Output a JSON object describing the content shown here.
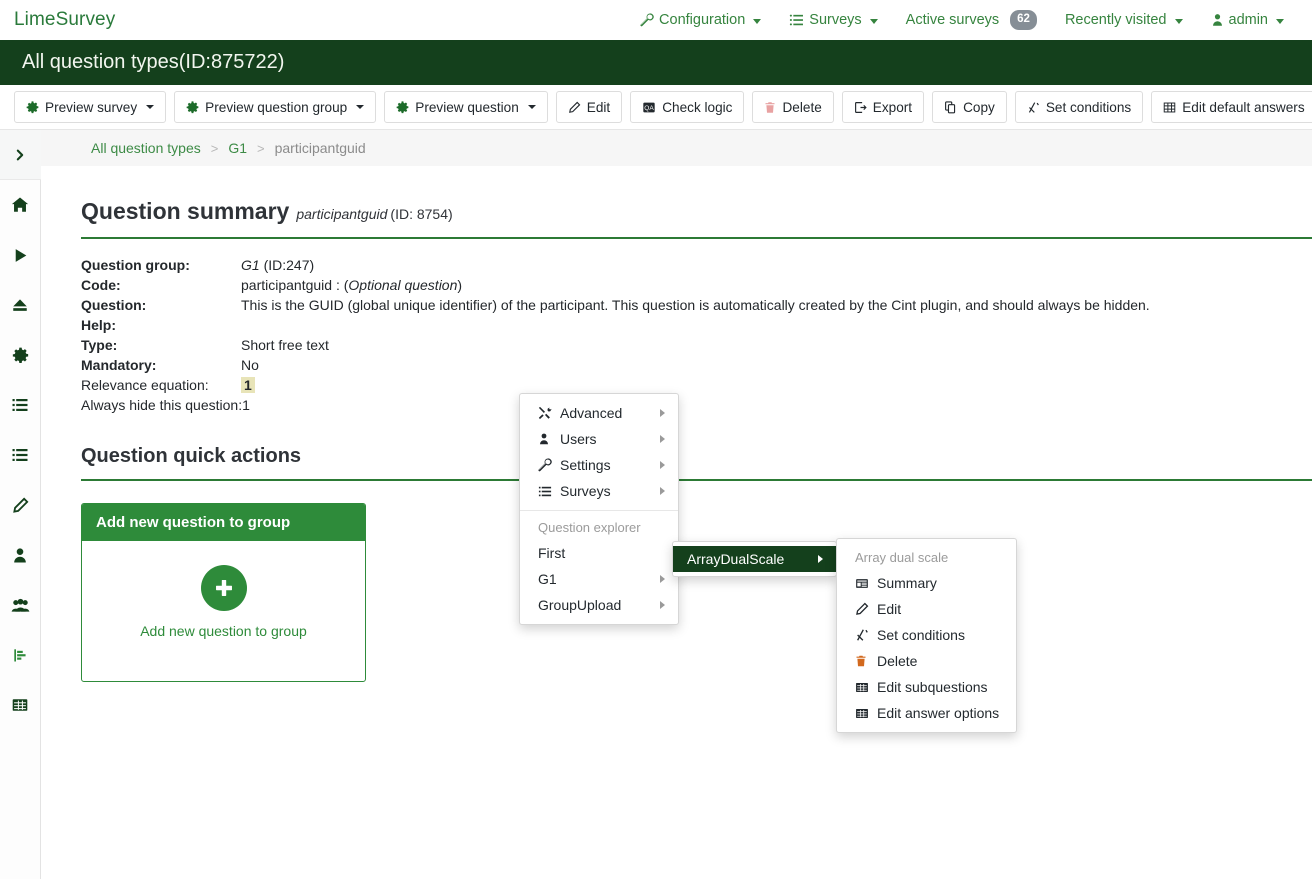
{
  "topnav": {
    "brand": "LimeSurvey",
    "items": [
      {
        "label": "Configuration",
        "icon": "wrench-icon",
        "caret": true
      },
      {
        "label": "Surveys",
        "icon": "list-icon",
        "caret": true
      },
      {
        "label": "Active surveys",
        "icon": "",
        "badge": "62"
      },
      {
        "label": "Recently visited",
        "icon": "",
        "caret": true
      },
      {
        "label": "admin",
        "icon": "user-icon",
        "caret": true
      }
    ]
  },
  "titlebar": {
    "title": "All question types(ID:875722)"
  },
  "toolbar": {
    "buttons": [
      {
        "label": "Preview survey",
        "icon": "gear-icon",
        "caret": true
      },
      {
        "label": "Preview question group",
        "icon": "gear-icon",
        "caret": true
      },
      {
        "label": "Preview question",
        "icon": "gear-icon",
        "caret": true
      },
      {
        "label": "Edit",
        "icon": "pencil-icon",
        "caret": false
      },
      {
        "label": "Check logic",
        "icon": "qa-icon",
        "caret": false
      },
      {
        "label": "Delete",
        "icon": "trash-icon",
        "caret": false
      },
      {
        "label": "Export",
        "icon": "export-icon",
        "caret": false
      },
      {
        "label": "Copy",
        "icon": "copy-icon",
        "caret": false
      },
      {
        "label": "Set conditions",
        "icon": "conditions-icon",
        "caret": false
      },
      {
        "label": "Edit default answers",
        "icon": "table-icon",
        "caret": false
      }
    ]
  },
  "sidebar": {
    "toggle_icon": "chevron-right-icon",
    "items": [
      {
        "icon": "home-icon",
        "name": "sidebar-item-home"
      },
      {
        "icon": "play-icon",
        "name": "sidebar-item-run"
      },
      {
        "icon": "eject-icon",
        "name": "sidebar-item-eject"
      },
      {
        "icon": "gear-icon",
        "name": "sidebar-item-settings"
      },
      {
        "icon": "list-icon",
        "name": "sidebar-item-structure"
      },
      {
        "icon": "list-icon",
        "name": "sidebar-item-questions"
      },
      {
        "icon": "pencil-icon",
        "name": "sidebar-item-edit"
      },
      {
        "icon": "user-icon",
        "name": "sidebar-item-participants"
      },
      {
        "icon": "users-icon",
        "name": "sidebar-item-users"
      },
      {
        "icon": "statistics-icon",
        "name": "sidebar-item-statistics"
      },
      {
        "icon": "table-icon",
        "name": "sidebar-item-responses"
      }
    ]
  },
  "breadcrumb": {
    "items": [
      {
        "label": "All question types",
        "current": false
      },
      {
        "label": "G1",
        "current": false
      },
      {
        "label": "participantguid",
        "current": true
      }
    ],
    "separator": ">"
  },
  "question_summary": {
    "heading": "Question summary",
    "code_italic": "participantguid",
    "id_text": "(ID: 8754)",
    "rows": [
      {
        "label": "Question group:",
        "value_italic": "G1",
        "value": "(ID:247)",
        "bold_label": true
      },
      {
        "label": "Code:",
        "value_pre": "participantguid : (",
        "value_italic": "Optional question",
        "value_post": ")",
        "bold_label": true
      },
      {
        "label": "Question:",
        "value": "This is the GUID (global unique identifier) of the participant. This question is automatically created by the Cint plugin, and should always be hidden.",
        "bold_label": true
      },
      {
        "label": "Help:",
        "value": "",
        "bold_label": true
      },
      {
        "label": "Type:",
        "value": "Short free text",
        "bold_label": true
      },
      {
        "label": "Mandatory:",
        "value": "No",
        "bold_label": true
      },
      {
        "label": "Relevance equation:",
        "value": "1",
        "bold_label": false,
        "highlight": true
      },
      {
        "label": "Always hide this question:1",
        "value": "",
        "bold_label": false
      }
    ]
  },
  "quick_actions": {
    "heading": "Question quick actions",
    "card": {
      "header": "Add new question to group",
      "button_label": "Add new question to group",
      "icon": "plus-icon"
    }
  },
  "menus": {
    "main": {
      "items": [
        {
          "label": "Advanced",
          "icon": "tools-icon",
          "arrow": true
        },
        {
          "label": "Users",
          "icon": "user-icon",
          "arrow": true
        },
        {
          "label": "Settings",
          "icon": "wrench-icon",
          "arrow": true
        },
        {
          "label": "Surveys",
          "icon": "list-icon",
          "arrow": true
        }
      ],
      "section_header": "Question explorer",
      "explorer_items": [
        {
          "label": "First",
          "arrow": false
        },
        {
          "label": "G1",
          "arrow": true
        },
        {
          "label": "GroupUpload",
          "arrow": true
        }
      ]
    },
    "group_submenu": {
      "items": [
        {
          "label": "ArrayDualScale",
          "arrow": true,
          "selected": true
        }
      ]
    },
    "question_submenu": {
      "header": "Array dual scale",
      "items": [
        {
          "label": "Summary",
          "icon": "summary-icon",
          "color": "default"
        },
        {
          "label": "Edit",
          "icon": "pencil-icon",
          "color": "default"
        },
        {
          "label": "Set conditions",
          "icon": "conditions-icon",
          "color": "default"
        },
        {
          "label": "Delete",
          "icon": "trash-icon",
          "color": "orange"
        },
        {
          "label": "Edit subquestions",
          "icon": "table-icon",
          "color": "default"
        },
        {
          "label": "Edit answer options",
          "icon": "table-icon",
          "color": "default"
        }
      ]
    }
  },
  "colors": {
    "brand_green": "#2a7a3b",
    "dark_green": "#14401c",
    "accent_green": "#2e8b3a",
    "rule_green": "#2c7a35",
    "badge_gray": "#868e96",
    "highlight_yellow": "#e8e4b8",
    "delete_orange": "#d2691e"
  }
}
